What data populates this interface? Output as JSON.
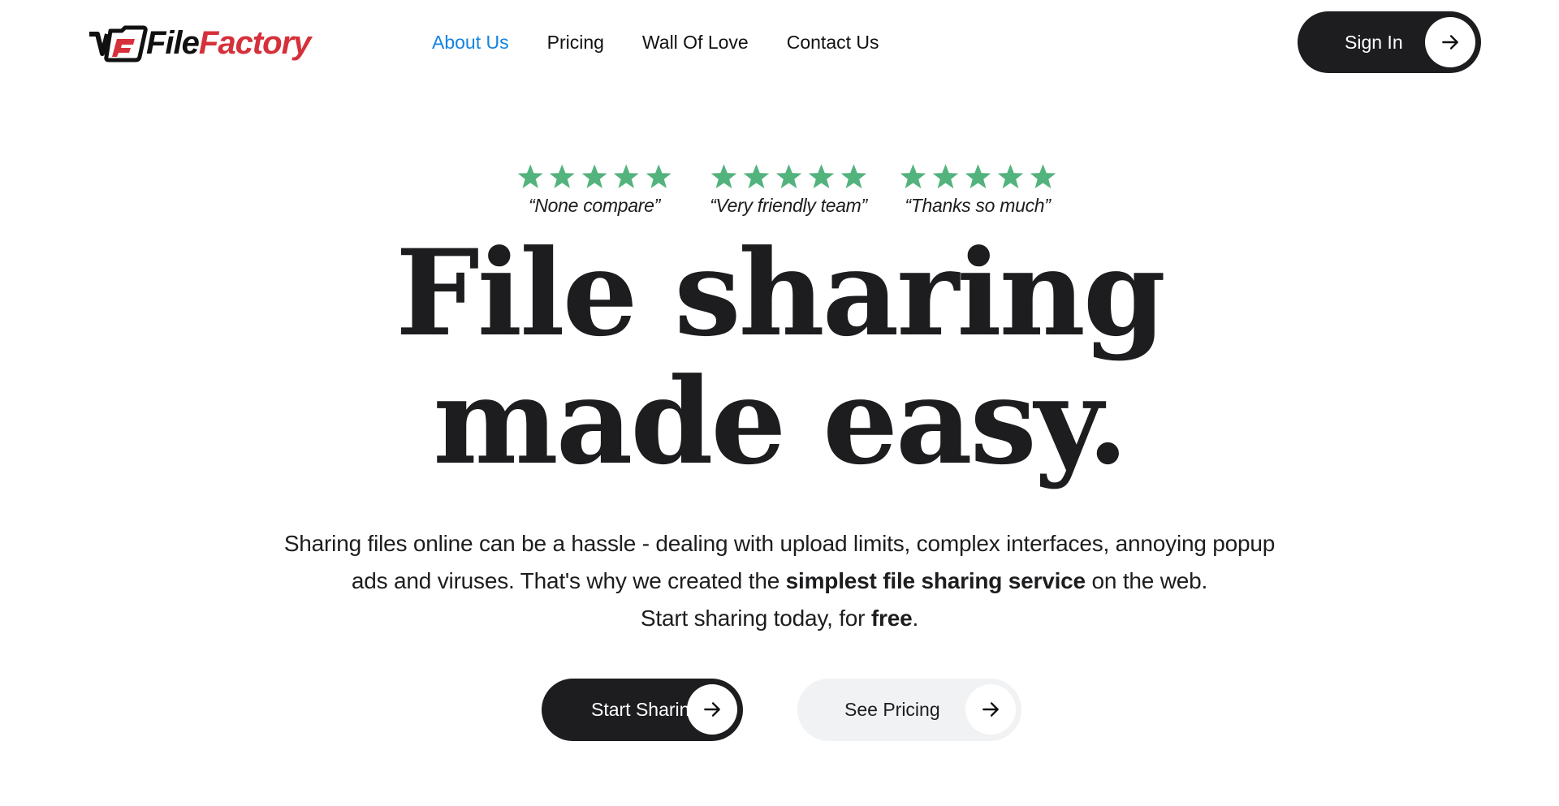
{
  "header": {
    "logo": {
      "part1": "File",
      "part2": "Factory",
      "icon": "filefactory-logo-icon"
    },
    "nav": [
      {
        "label": "About Us",
        "active": true
      },
      {
        "label": "Pricing",
        "active": false
      },
      {
        "label": "Wall Of Love",
        "active": false
      },
      {
        "label": "Contact Us",
        "active": false
      }
    ],
    "sign_in": {
      "label": "Sign In",
      "icon": "arrow-right-icon"
    }
  },
  "reviews": [
    {
      "rating": 5,
      "quote": "“None compare”"
    },
    {
      "rating": 5,
      "quote": "“Very friendly team”"
    },
    {
      "rating": 5,
      "quote": "“Thanks so much”"
    }
  ],
  "hero": {
    "headline_line1": "File sharing",
    "headline_line2": "made easy.",
    "sub_line1": "Sharing files online can be a hassle - dealing with upload limits, complex interfaces, annoying popup",
    "sub_line2_a": "ads and viruses. That's why we created the ",
    "sub_line2_bold": "simplest file sharing service",
    "sub_line2_b": " on the web.",
    "sub_line3_a": "Start sharing today, for ",
    "sub_line3_bold": "free",
    "sub_line3_b": "."
  },
  "cta": {
    "primary": {
      "label": "Start Sharing",
      "icon": "arrow-right-icon"
    },
    "secondary": {
      "label": "See Pricing",
      "icon": "arrow-right-icon"
    }
  },
  "colors": {
    "accent_link": "#1483e0",
    "star_green": "#53b37d",
    "dark": "#1d1d1f",
    "logo_red": "#d6303a",
    "light_button": "#f1f2f4"
  }
}
